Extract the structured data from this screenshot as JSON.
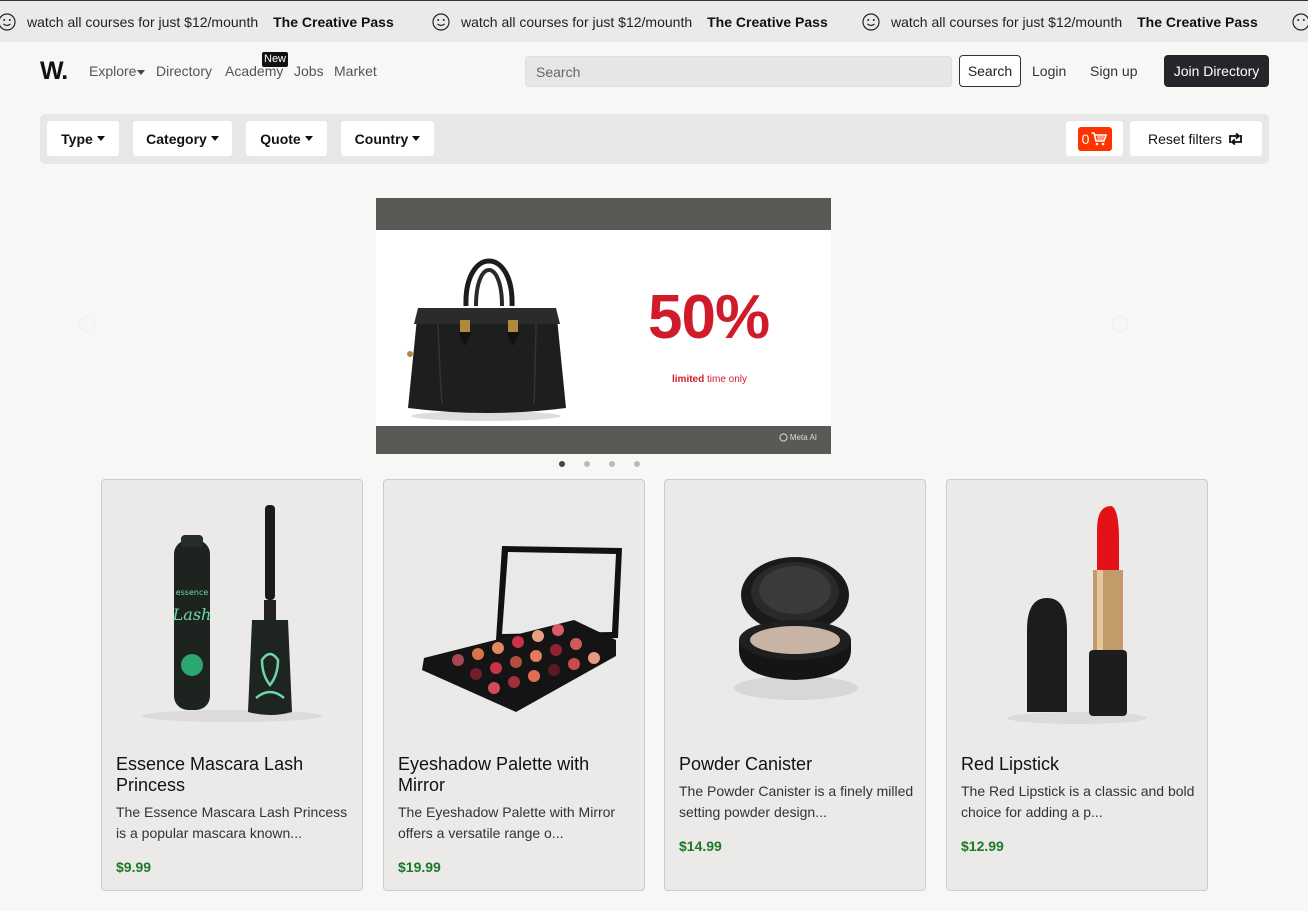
{
  "marquee": {
    "items": [
      {
        "text": "watch all courses for just $12/mounth",
        "pass": "The Creative Pass"
      },
      {
        "text": "watch all courses for just $12/mounth",
        "pass": "The Creative Pass"
      },
      {
        "text": "watch all courses for just $12/mounth",
        "pass": "The Creative Pass"
      }
    ]
  },
  "nav": {
    "logo": "W.",
    "explore": "Explore",
    "directory": "Directory",
    "academy": "Academy",
    "academy_badge": "New",
    "jobs": "Jobs",
    "market": "Market",
    "search_placeholder": "Search",
    "search_button": "Search",
    "login": "Login",
    "signup": "Sign up",
    "join": "Join Directory"
  },
  "filters": {
    "type": "Type",
    "category": "Category",
    "quote": "Quote",
    "country": "Country",
    "cart_count": "0",
    "reset": "Reset filters"
  },
  "carousel": {
    "promo_percent": "50%",
    "promo_limited": "limited",
    "promo_rest": "time only",
    "watermark": "Meta AI",
    "slide_count": 4,
    "active_slide": 1
  },
  "products": [
    {
      "title": "Essence Mascara Lash Princess",
      "desc": "The Essence Mascara Lash Princess is a popular mascara known...",
      "price": "$9.99",
      "image": "mascara"
    },
    {
      "title": "Eyeshadow Palette with Mirror",
      "desc": "The Eyeshadow Palette with Mirror offers a versatile range o...",
      "price": "$19.99",
      "image": "eyeshadow-palette"
    },
    {
      "title": "Powder Canister",
      "desc": "The Powder Canister is a finely milled setting powder design...",
      "price": "$14.99",
      "image": "powder-canister"
    },
    {
      "title": "Red Lipstick",
      "desc": "The Red Lipstick is a classic and bold choice for adding a p...",
      "price": "$12.99",
      "image": "red-lipstick"
    }
  ],
  "colors": {
    "accent_red": "#ff3300",
    "price_green": "#1a7a25",
    "dark_button": "#24262a"
  }
}
